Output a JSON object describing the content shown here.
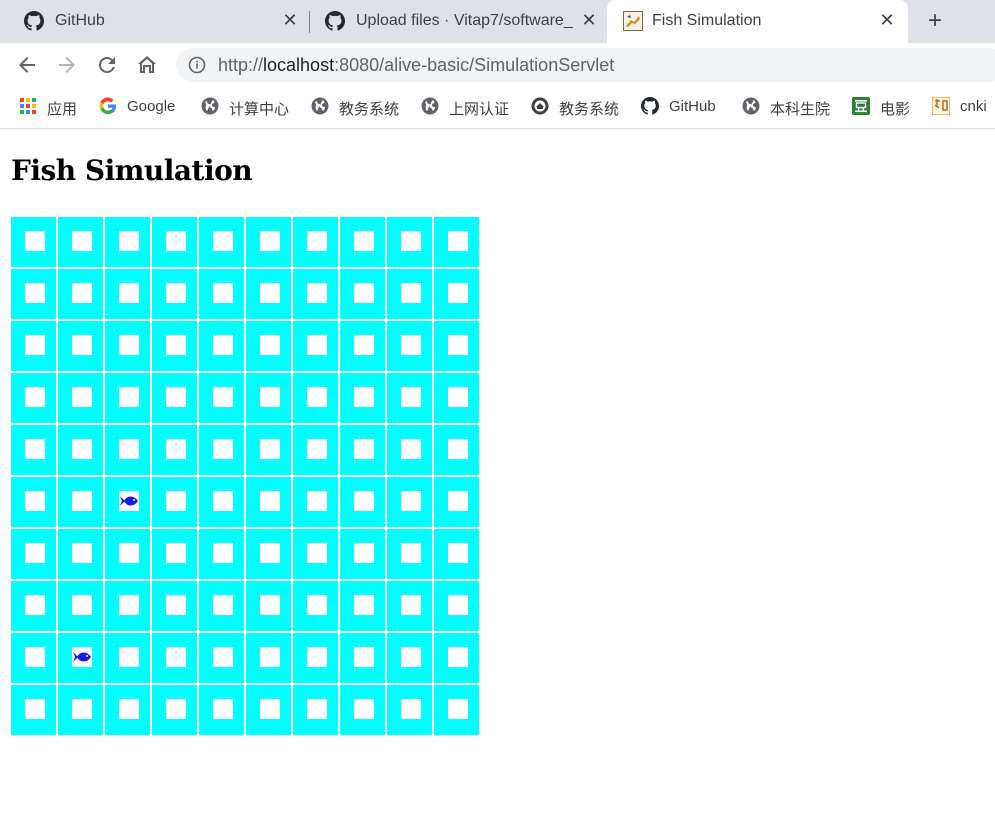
{
  "tabs": [
    {
      "title": "GitHub",
      "icon": "github-icon"
    },
    {
      "title": "Upload files · Vitap7/software_",
      "icon": "github-icon"
    },
    {
      "title": "Fish Simulation",
      "icon": "tomcat-icon",
      "active": true
    }
  ],
  "toolbar": {
    "url_prefix": "http://",
    "url_host": "localhost",
    "url_rest": ":8080/alive-basic/SimulationServlet"
  },
  "bookmarks": [
    {
      "label": "应用",
      "icon": "apps-grid-icon"
    },
    {
      "label": "Google",
      "icon": "google-icon"
    },
    {
      "label": "计算中心",
      "icon": "globe-icon"
    },
    {
      "label": "教务系统",
      "icon": "globe-icon"
    },
    {
      "label": "上网认证",
      "icon": "globe-icon"
    },
    {
      "label": "教务系统",
      "icon": "school-emblem-icon"
    },
    {
      "label": "GitHub",
      "icon": "github-icon"
    },
    {
      "label": "本科生院",
      "icon": "globe-icon"
    },
    {
      "label": "电影",
      "icon": "douban-icon"
    },
    {
      "label": "cnki",
      "icon": "cnki-icon"
    }
  ],
  "page": {
    "title": "Fish Simulation"
  },
  "simulation": {
    "rows": 10,
    "cols": 10,
    "water_color": "#00ffff",
    "fish_color": "#1a1adf",
    "fish": [
      {
        "row": 6,
        "col": 3
      },
      {
        "row": 9,
        "col": 2
      }
    ]
  }
}
